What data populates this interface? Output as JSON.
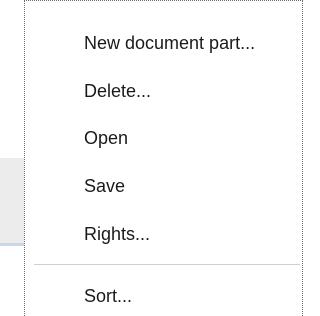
{
  "context_menu": {
    "items": [
      {
        "label": "New document part..."
      },
      {
        "label": "Delete..."
      },
      {
        "label": "Open"
      },
      {
        "label": "Save"
      },
      {
        "label": "Rights..."
      },
      {
        "label": "Sort..."
      }
    ]
  }
}
